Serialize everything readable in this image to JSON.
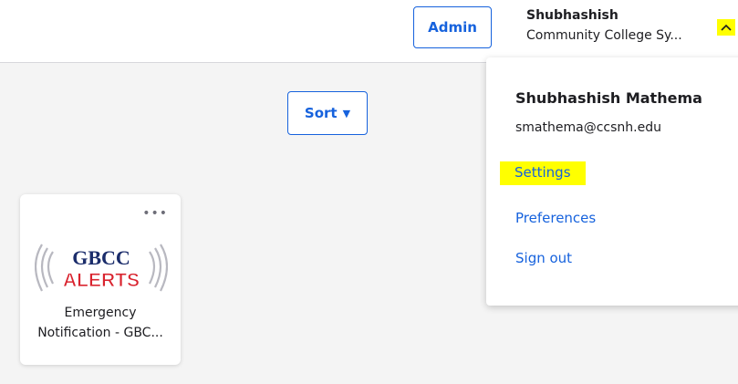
{
  "header": {
    "admin_label": "Admin",
    "user_name": "Shubhashish",
    "user_org": "Community College Sy..."
  },
  "toolbar": {
    "sort_label": "Sort"
  },
  "apps": [
    {
      "logo_top": "GBCC",
      "logo_bottom": "ALERTS",
      "label_line1": "Emergency",
      "label_line2": "Notification - GBC..."
    }
  ],
  "user_menu": {
    "full_name": "Shubhashish Mathema",
    "email": "smathema@ccsnh.edu",
    "items": [
      {
        "label": "Settings"
      },
      {
        "label": "Preferences"
      },
      {
        "label": "Sign out"
      }
    ]
  },
  "colors": {
    "accent": "#1662dd",
    "highlight": "#ffff00",
    "logo_red": "#d9232e",
    "logo_blue": "#1b2d6b"
  },
  "icons": [
    "chevron-up-icon",
    "caret-down-icon",
    "more-horizontal-icon"
  ]
}
